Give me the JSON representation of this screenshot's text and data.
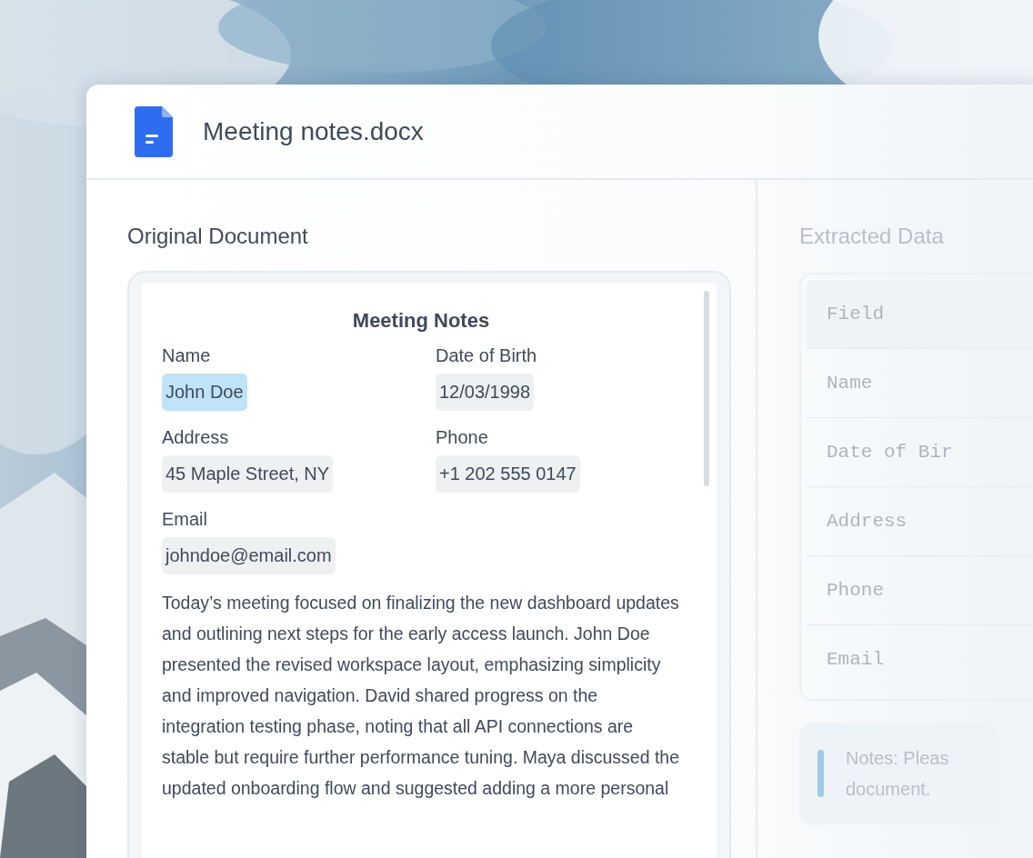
{
  "window": {
    "title": "Meeting notes.docx"
  },
  "original": {
    "heading": "Original Document",
    "document": {
      "title": "Meeting Notes",
      "fields": [
        {
          "label": "Name",
          "value": "John Doe",
          "highlighted": true
        },
        {
          "label": "Date of Birth",
          "value": "12/03/1998",
          "highlighted": false
        },
        {
          "label": "Address",
          "value": "45 Maple Street, NY",
          "highlighted": false
        },
        {
          "label": "Phone",
          "value": "+1 202 555 0147",
          "highlighted": false
        },
        {
          "label": "Email",
          "value": "johndoe@email.com",
          "highlighted": false
        }
      ],
      "body": "Today’s meeting focused on finalizing the new dashboard updates and outlining next steps for the early access launch. John Doe presented the revised workspace layout, emphasizing simplicity and improved navigation. David shared progress on the integration testing phase, noting that all API connections are stable but require further performance tuning. Maya discussed the updated onboarding flow and suggested adding a more personal"
    }
  },
  "extracted": {
    "heading": "Extracted Data",
    "table": {
      "header": "Field",
      "rows": [
        "Name",
        "Date of Bir",
        "Address",
        "Phone",
        "Email"
      ]
    },
    "notes": "Notes: Pleas document."
  }
}
